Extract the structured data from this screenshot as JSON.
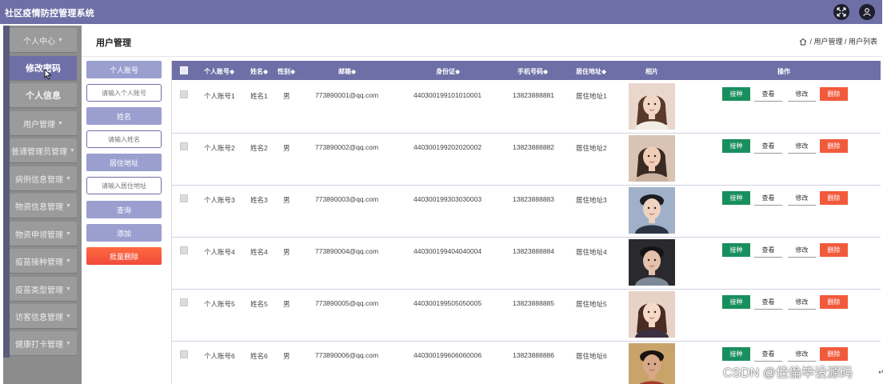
{
  "app": {
    "title": "社区疫情防控管理系统"
  },
  "colors": {
    "primary": "#6e6fa6",
    "sidebar": "#8c8c8c",
    "vaccinate": "#1a8f5e",
    "danger": "#f25a3c"
  },
  "topbar": {
    "icons": [
      "fullscreen-icon",
      "user-icon"
    ]
  },
  "sidebar": {
    "items": [
      {
        "label": "个人中心",
        "has_caret": true
      },
      {
        "label": "修改密码",
        "has_caret": false
      },
      {
        "label": "个人信息",
        "has_caret": false
      },
      {
        "label": "用户管理",
        "has_caret": true
      },
      {
        "label": "普通管理员管理",
        "has_caret": true
      },
      {
        "label": "病例信息管理",
        "has_caret": true
      },
      {
        "label": "物资信息管理",
        "has_caret": true
      },
      {
        "label": "物资申领管理",
        "has_caret": true
      },
      {
        "label": "疫苗接种管理",
        "has_caret": true
      },
      {
        "label": "疫苗类型管理",
        "has_caret": true
      },
      {
        "label": "访客信息管理",
        "has_caret": true
      },
      {
        "label": "健康打卡管理",
        "has_caret": true
      }
    ],
    "caret": "▼"
  },
  "header": {
    "title": "用户管理",
    "breadcrumb": "/ 用户管理 / 用户列表"
  },
  "search": {
    "account_label": "个人账号",
    "account_placeholder": "请输入个人账号",
    "name_label": "姓名",
    "name_placeholder": "请输入姓名",
    "address_label": "居住地址",
    "address_placeholder": "请输入居住地址",
    "query_button": "查询",
    "add_button": "添加",
    "batch_delete_button": "批量删除"
  },
  "table": {
    "columns": {
      "account": "个人账号◆",
      "name": "姓名◆",
      "gender": "性别◆",
      "email": "邮箱◆",
      "id_card": "身份证◆",
      "phone": "手机号码◆",
      "address": "居住地址◆",
      "photo": "相片",
      "actions": "操作"
    },
    "rows": [
      {
        "account": "个人账号1",
        "name": "姓名1",
        "gender": "男",
        "email": "773890001@qq.com",
        "id_card": "440300199101010001",
        "phone": "13823888881",
        "address": "居住地址1",
        "photo": "portrait-woman-1"
      },
      {
        "account": "个人账号2",
        "name": "姓名2",
        "gender": "男",
        "email": "773890002@qq.com",
        "id_card": "440300199202020002",
        "phone": "13823888882",
        "address": "居住地址2",
        "photo": "portrait-woman-2"
      },
      {
        "account": "个人账号3",
        "name": "姓名3",
        "gender": "男",
        "email": "773890003@qq.com",
        "id_card": "440300199303030003",
        "phone": "13823888883",
        "address": "居住地址3",
        "photo": "portrait-man-3"
      },
      {
        "account": "个人账号4",
        "name": "姓名4",
        "gender": "男",
        "email": "773890004@qq.com",
        "id_card": "440300199404040004",
        "phone": "13823888884",
        "address": "居住地址4",
        "photo": "portrait-man-4"
      },
      {
        "account": "个人账号5",
        "name": "姓名5",
        "gender": "男",
        "email": "773890005@qq.com",
        "id_card": "440300199505050005",
        "phone": "13823888885",
        "address": "居住地址5",
        "photo": "portrait-woman-5"
      },
      {
        "account": "个人账号6",
        "name": "姓名6",
        "gender": "男",
        "email": "773890006@qq.com",
        "id_card": "440300199606060006",
        "phone": "13823888886",
        "address": "居住地址6",
        "photo": "portrait-man-6"
      }
    ],
    "actions": {
      "vaccinate": "接种",
      "view": "查看",
      "edit": "修改",
      "delete": "删除"
    }
  },
  "watermark": "CSDN @佳倫毕设源码"
}
